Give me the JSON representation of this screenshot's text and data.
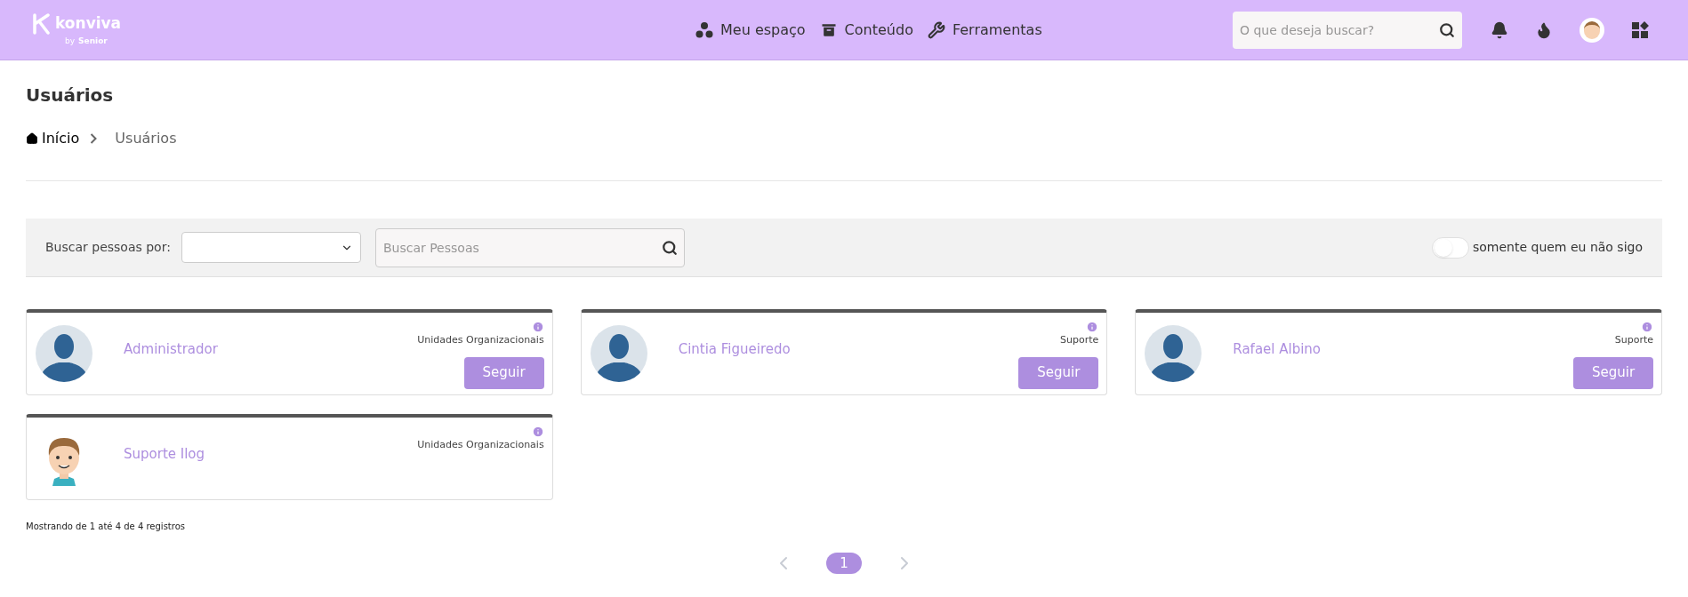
{
  "header": {
    "logo": {
      "name": "konviva",
      "tagline": "by",
      "brand": "Senior"
    },
    "nav": [
      {
        "label": "Meu espaço"
      },
      {
        "label": "Conteúdo"
      },
      {
        "label": "Ferramentas"
      }
    ],
    "search": {
      "placeholder": "O que deseja buscar?"
    }
  },
  "page": {
    "title": "Usuários",
    "breadcrumb": [
      {
        "label": "Início",
        "kind": "home"
      },
      {
        "label": "Usuários",
        "kind": "current"
      }
    ]
  },
  "filter": {
    "label": "Buscar pessoas por:",
    "search_placeholder": "Buscar Pessoas",
    "toggle": {
      "label": "somente quem eu não sigo",
      "on": false
    }
  },
  "users": [
    {
      "name": "Administrador",
      "group": "Unidades Organizacionais",
      "kind": "silhouette",
      "follow_button": "Seguir"
    },
    {
      "name": "Cintia Figueiredo",
      "group": "Suporte",
      "kind": "silhouette",
      "follow_button": "Seguir"
    },
    {
      "name": "Rafael Albino",
      "group": "Suporte",
      "kind": "silhouette",
      "follow_button": "Seguir"
    },
    {
      "name": "Suporte Ilog",
      "group": "Unidades Organizacionais",
      "kind": "cartoon"
    }
  ],
  "summary": "Mostrando de 1 até 4 de 4 registros",
  "pagination": {
    "pages": [
      {
        "label": "1",
        "selected": true
      }
    ]
  }
}
